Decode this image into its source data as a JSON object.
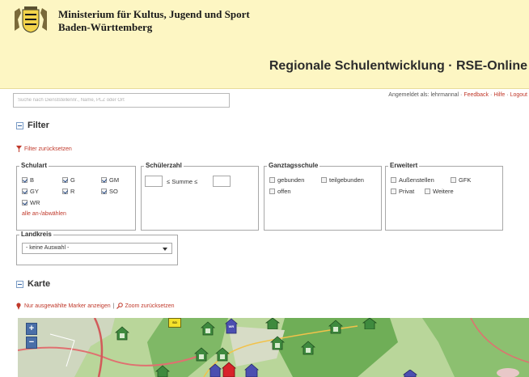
{
  "header": {
    "ministry_line1": "Ministerium für Kultus, Jugend und Sport",
    "ministry_line2": "Baden-Württemberg",
    "app_title": "Regionale Schulentwicklung · RSE-Online"
  },
  "search": {
    "placeholder": "Suche nach Dienststellennr., Name, PLZ oder Ort"
  },
  "login": {
    "prefix": "Angemeldet als: lehrmannal ·",
    "feedback": "Feedback",
    "help": "Hilfe",
    "logout": "Logout"
  },
  "filter": {
    "title": "Filter",
    "reset_label": "Filter zurücksetzen",
    "schulart": {
      "legend": "Schulart",
      "items": [
        {
          "label": "B",
          "checked": true
        },
        {
          "label": "G",
          "checked": true
        },
        {
          "label": "GM",
          "checked": true
        },
        {
          "label": "GY",
          "checked": true
        },
        {
          "label": "R",
          "checked": true
        },
        {
          "label": "SO",
          "checked": true
        },
        {
          "label": "WR",
          "checked": true
        }
      ],
      "toggle_all": "alle an-/abwählen"
    },
    "schuelerzahl": {
      "legend": "Schülerzahl",
      "sum_label": "≤ Summe ≤"
    },
    "ganztag": {
      "legend": "Ganztagsschule",
      "items": [
        {
          "label": "gebunden",
          "checked": false
        },
        {
          "label": "teilgebunden",
          "checked": false
        },
        {
          "label": "offen",
          "checked": false
        }
      ]
    },
    "erweitert": {
      "legend": "Erweitert",
      "items": [
        {
          "label": "Außenstellen",
          "checked": false
        },
        {
          "label": "GFK",
          "checked": false
        },
        {
          "label": "Privat",
          "checked": false
        },
        {
          "label": "Weitere",
          "checked": false
        }
      ]
    },
    "landkreis": {
      "legend": "Landkreis",
      "selected": "- keine Auswahl -"
    }
  },
  "karte": {
    "title": "Karte",
    "show_selected_label": "Nur ausgewählte Marker anzeigen",
    "separator": "|",
    "zoom_reset_label": "Zoom zurücksetzen",
    "zoom_in": "+",
    "zoom_out": "−",
    "marker_labels": {
      "so": "SO",
      "g": "G",
      "wr": "WR",
      "gy": "GY"
    }
  },
  "colors": {
    "header_bg": "#fdf6c3",
    "link_red": "#c0392b",
    "map_green": "#a9cc8a",
    "marker_green": "#3e8a3e",
    "marker_blue": "#4b4fb0",
    "marker_red": "#d8232a",
    "marker_yellow": "#f3e12b"
  }
}
